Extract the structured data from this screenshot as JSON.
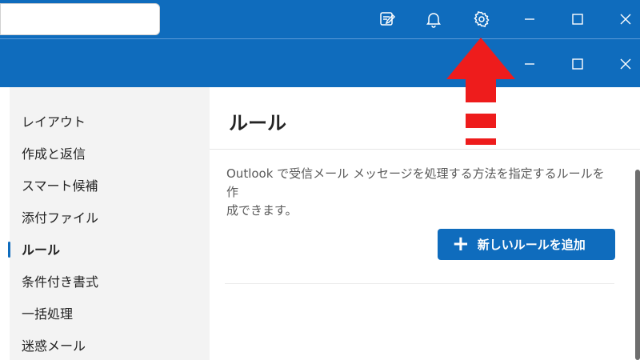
{
  "titlebar": {
    "search_placeholder": "",
    "icons": [
      "compose-icon",
      "bell-icon",
      "gear-icon",
      "minimize-icon",
      "maximize-icon",
      "close-icon"
    ]
  },
  "settings_window": {
    "icons": [
      "minimize-icon",
      "maximize-icon",
      "close-icon"
    ]
  },
  "sidebar": {
    "items": [
      {
        "label": "レイアウト"
      },
      {
        "label": "作成と返信"
      },
      {
        "label": "スマート候補"
      },
      {
        "label": "添付ファイル"
      },
      {
        "label": "ルール",
        "active": true
      },
      {
        "label": "条件付き書式"
      },
      {
        "label": "一括処理"
      },
      {
        "label": "迷惑メール"
      }
    ]
  },
  "main": {
    "title": "ルール",
    "description_line1": "Outlook で受信メール メッセージを処理する方法を指定するルールを作",
    "description_line2": "成できます。",
    "add_rule_label": "新しいルールを追加",
    "add_rule_icon": "plus-icon"
  },
  "annotation": {
    "arrow_color": "#ee1c1c",
    "points_to": "gear-icon"
  },
  "colors": {
    "brand": "#0f6cbd",
    "sidebar_bg": "#f3f3f3",
    "text": "#242424"
  }
}
